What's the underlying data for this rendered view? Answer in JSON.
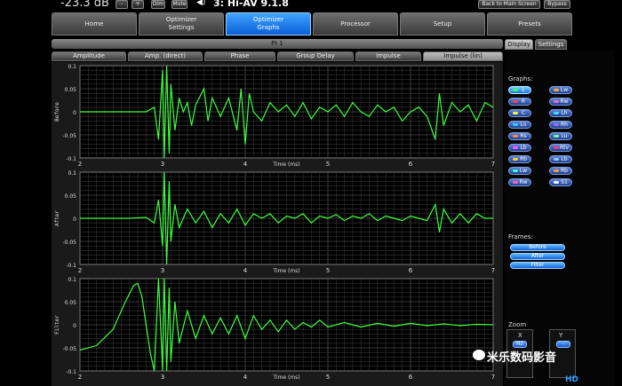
{
  "topbar": {
    "volume": "-23.3 dB",
    "minus": "-",
    "plus": "+",
    "dim": "Dim",
    "mute": "Mute",
    "preset": "3: Hi-AV 9.1.8",
    "back_to_main": "Back to Main Screen",
    "bypass": "Bypass"
  },
  "main_tabs": [
    {
      "label": "Home",
      "active": false
    },
    {
      "label": "Optimizer\nSettings",
      "active": false
    },
    {
      "label": "Optimizer\nGraphs",
      "active": true
    },
    {
      "label": "Processor",
      "active": false
    },
    {
      "label": "Setup",
      "active": false
    },
    {
      "label": "Presets",
      "active": false
    }
  ],
  "title": "Pt 1",
  "sub_tabs": [
    {
      "label": "Amplitude",
      "active": false
    },
    {
      "label": "Amp. (direct)",
      "active": false
    },
    {
      "label": "Phase",
      "active": false
    },
    {
      "label": "Group Delay",
      "active": false
    },
    {
      "label": "Impulse",
      "active": false
    },
    {
      "label": "Impulse (lin)",
      "active": true
    }
  ],
  "side_tabs": [
    {
      "label": "Display",
      "active": true
    },
    {
      "label": "Settings",
      "active": false
    }
  ],
  "side": {
    "graphs_label": "Graphs:",
    "frames_label": "Frames:",
    "zoom_label": "Zoom",
    "zoom_x": "X",
    "zoom_y": "Y",
    "zoom_x_btn": "Hz",
    "zoom_y_btn": "-",
    "channels": [
      {
        "label": "L",
        "color": "#33ff66",
        "active": true
      },
      {
        "label": "Lw",
        "color": "#ffaa33",
        "active": false
      },
      {
        "label": "R",
        "color": "#ff4444",
        "active": false
      },
      {
        "label": "Rw",
        "color": "#ff66cc",
        "active": false
      },
      {
        "label": "C",
        "color": "#ffee44",
        "active": false
      },
      {
        "label": "Lh",
        "color": "#44ddff",
        "active": false
      },
      {
        "label": "Ls",
        "color": "#33ccff",
        "active": false
      },
      {
        "label": "Rh",
        "color": "#aa66ff",
        "active": false
      },
      {
        "label": "Rs",
        "color": "#ff8844",
        "active": false
      },
      {
        "label": "Lu",
        "color": "#66ff99",
        "active": false
      },
      {
        "label": "Lb",
        "color": "#ff55ff",
        "active": false
      },
      {
        "label": "Rtv",
        "color": "#ff3388",
        "active": false
      },
      {
        "label": "Rb",
        "color": "#ffcc33",
        "active": false
      },
      {
        "label": "Lb",
        "color": "#88ccff",
        "active": false
      },
      {
        "label": "Lw",
        "color": "#33ffcc",
        "active": false
      },
      {
        "label": "Rb",
        "color": "#ff9933",
        "active": false
      },
      {
        "label": "Rw",
        "color": "#ff66aa",
        "active": false
      },
      {
        "label": "S1",
        "color": "#ffffff",
        "active": false
      }
    ],
    "frames": [
      "Before",
      "After",
      "Filter"
    ]
  },
  "watermark": {
    "cn": "米乐数码影音",
    "hd": "HD"
  },
  "chart_data": [
    {
      "type": "line",
      "ylabel": "Before",
      "xlabel": "Time (ms)",
      "x_ticks": [
        "2",
        "3",
        "4",
        "5",
        "6",
        "7"
      ],
      "y_ticks": [
        "0.1",
        "0.05",
        "0",
        "-0.05",
        "-0.1"
      ],
      "xlim": [
        2,
        7
      ],
      "ylim": [
        -0.1,
        0.1
      ],
      "grid": true,
      "series": [
        {
          "x": [
            2.0,
            2.8,
            2.9,
            2.95,
            3.0,
            3.02,
            3.05,
            3.08,
            3.1,
            3.15,
            3.2,
            3.25,
            3.3,
            3.35,
            3.4,
            3.5,
            3.55,
            3.6,
            3.7,
            3.8,
            3.9,
            3.95,
            4.0,
            4.05,
            4.1,
            4.2,
            4.3,
            4.4,
            4.5,
            4.6,
            4.7,
            4.8,
            4.9,
            5.0,
            5.1,
            5.2,
            5.3,
            5.4,
            5.5,
            5.6,
            5.7,
            5.8,
            5.9,
            6.0,
            6.1,
            6.2,
            6.3,
            6.35,
            6.4,
            6.5,
            6.6,
            6.7,
            6.8,
            6.9,
            7.0
          ],
          "y": [
            0.0,
            0.0,
            0.01,
            -0.06,
            0.09,
            -0.1,
            0.1,
            -0.09,
            0.06,
            -0.04,
            0.03,
            0.0,
            0.02,
            -0.03,
            0.015,
            0.05,
            -0.02,
            0.03,
            -0.01,
            0.03,
            -0.04,
            0.05,
            -0.07,
            0.04,
            0.0,
            -0.02,
            0.02,
            0.0,
            0.015,
            -0.01,
            0.02,
            -0.015,
            0.01,
            0.0,
            0.015,
            -0.01,
            0.02,
            0.0,
            -0.01,
            0.015,
            0.0,
            0.01,
            -0.02,
            0.0,
            0.01,
            -0.01,
            -0.06,
            0.04,
            -0.03,
            0.02,
            0.0,
            0.015,
            -0.02,
            0.02,
            0.01
          ]
        }
      ]
    },
    {
      "type": "line",
      "ylabel": "After",
      "xlabel": "Time (ms)",
      "x_ticks": [
        "2",
        "3",
        "4",
        "5",
        "6",
        "7"
      ],
      "y_ticks": [
        "0.1",
        "0.05",
        "0",
        "-0.05",
        "-0.1"
      ],
      "xlim": [
        2,
        7
      ],
      "ylim": [
        -0.1,
        0.1
      ],
      "grid": true,
      "series": [
        {
          "x": [
            2.0,
            2.6,
            2.8,
            2.9,
            2.95,
            3.0,
            3.02,
            3.05,
            3.08,
            3.1,
            3.15,
            3.2,
            3.3,
            3.4,
            3.5,
            3.6,
            3.7,
            3.8,
            3.9,
            4.0,
            4.1,
            4.2,
            4.3,
            4.4,
            4.5,
            4.6,
            4.7,
            4.8,
            4.9,
            5.0,
            5.1,
            5.2,
            5.3,
            5.4,
            5.5,
            5.6,
            5.7,
            5.8,
            5.9,
            6.0,
            6.1,
            6.2,
            6.3,
            6.35,
            6.4,
            6.5,
            6.6,
            6.7,
            6.8,
            6.9,
            7.0
          ],
          "y": [
            0.0,
            0.0,
            0.002,
            -0.01,
            0.04,
            -0.06,
            0.1,
            -0.1,
            0.08,
            -0.05,
            0.03,
            -0.02,
            0.02,
            -0.01,
            0.015,
            -0.02,
            0.01,
            -0.01,
            0.02,
            -0.015,
            0.01,
            0.0,
            0.01,
            -0.01,
            0.005,
            0.0,
            0.01,
            -0.01,
            0.005,
            0.0,
            0.008,
            -0.005,
            0.005,
            0.0,
            0.01,
            -0.005,
            0.005,
            0.0,
            -0.005,
            0.005,
            0.0,
            -0.005,
            0.03,
            -0.03,
            0.02,
            -0.01,
            0.01,
            -0.01,
            0.01,
            0.0,
            0.0
          ]
        }
      ]
    },
    {
      "type": "line",
      "ylabel": "Filter",
      "xlabel": "Time (ms)",
      "x_ticks": [
        "2",
        "3",
        "4",
        "5",
        "6",
        "7"
      ],
      "y_ticks": [
        "0.1",
        "0.05",
        "0",
        "-0.05",
        "-0.1"
      ],
      "xlim": [
        2,
        7
      ],
      "ylim": [
        -0.1,
        0.1
      ],
      "grid": true,
      "series": [
        {
          "x": [
            2.0,
            2.2,
            2.4,
            2.55,
            2.65,
            2.7,
            2.75,
            2.8,
            2.85,
            2.9,
            2.95,
            3.0,
            3.02,
            3.05,
            3.08,
            3.1,
            3.15,
            3.2,
            3.3,
            3.4,
            3.5,
            3.6,
            3.7,
            3.8,
            3.9,
            4.0,
            4.1,
            4.2,
            4.3,
            4.4,
            4.5,
            4.6,
            4.7,
            4.8,
            4.9,
            5.0,
            5.2,
            5.4,
            5.6,
            5.8,
            6.0,
            6.2,
            6.4,
            6.6,
            6.8,
            7.0
          ],
          "y": [
            -0.055,
            -0.045,
            -0.01,
            0.05,
            0.085,
            0.09,
            0.06,
            0.0,
            -0.06,
            -0.1,
            0.1,
            -0.1,
            0.1,
            -0.1,
            0.08,
            -0.08,
            0.05,
            -0.04,
            0.03,
            -0.03,
            0.02,
            -0.02,
            0.015,
            -0.02,
            0.02,
            -0.03,
            0.02,
            -0.01,
            0.01,
            -0.015,
            0.01,
            -0.01,
            0.005,
            -0.005,
            0.01,
            -0.005,
            0.005,
            -0.005,
            0.003,
            -0.003,
            0.003,
            -0.002,
            0.002,
            -0.002,
            0.001,
            0.0
          ]
        }
      ]
    }
  ]
}
